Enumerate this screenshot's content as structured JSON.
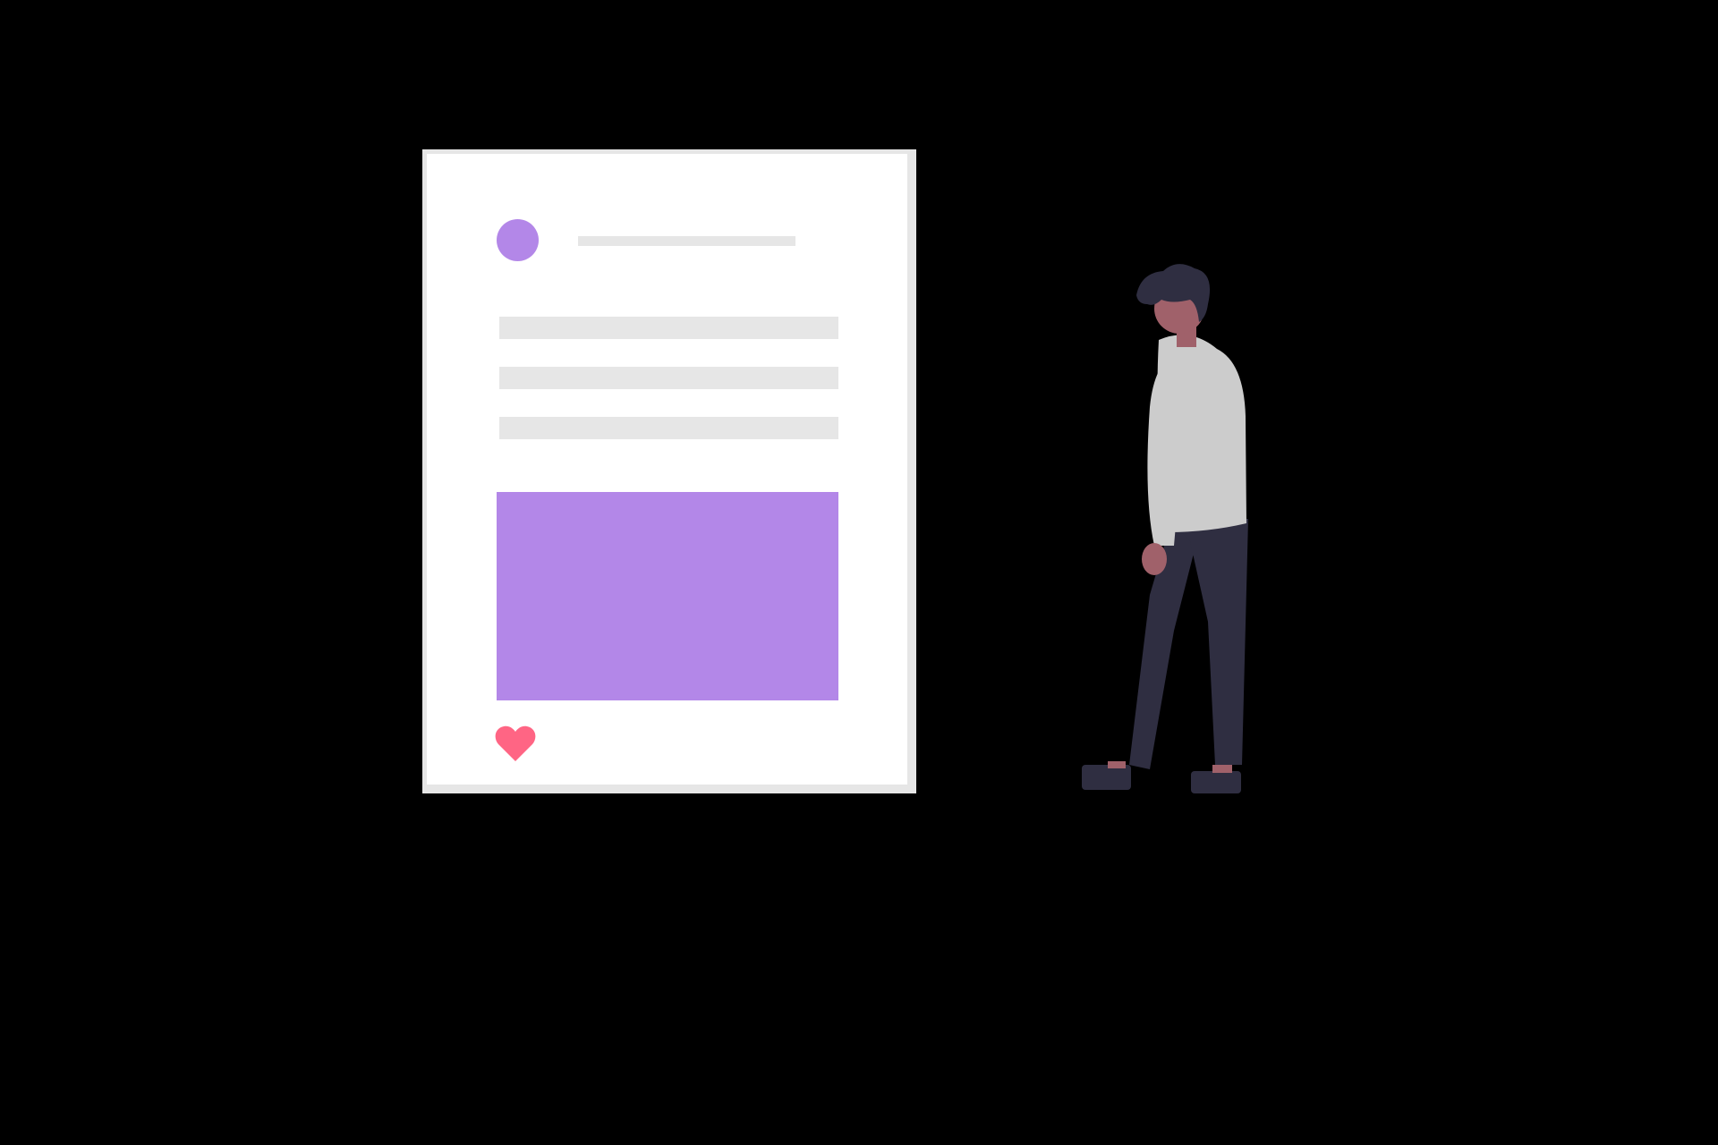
{
  "colors": {
    "background": "#000000",
    "card_border": "#e6e6e6",
    "card_fill": "#ffffff",
    "placeholder_line": "#e6e6e6",
    "accent_purple": "#b387e8",
    "heart": "#ff6584",
    "hair": "#2f2e41",
    "skin": "#a0616a",
    "shirt": "#cccccc",
    "pants": "#2f2e41",
    "shoes": "#2f2e41"
  },
  "post_card": {
    "avatar_icon": "avatar-circle",
    "like_icon": "heart-icon"
  },
  "person": {
    "icon": "standing-person-illustration"
  }
}
